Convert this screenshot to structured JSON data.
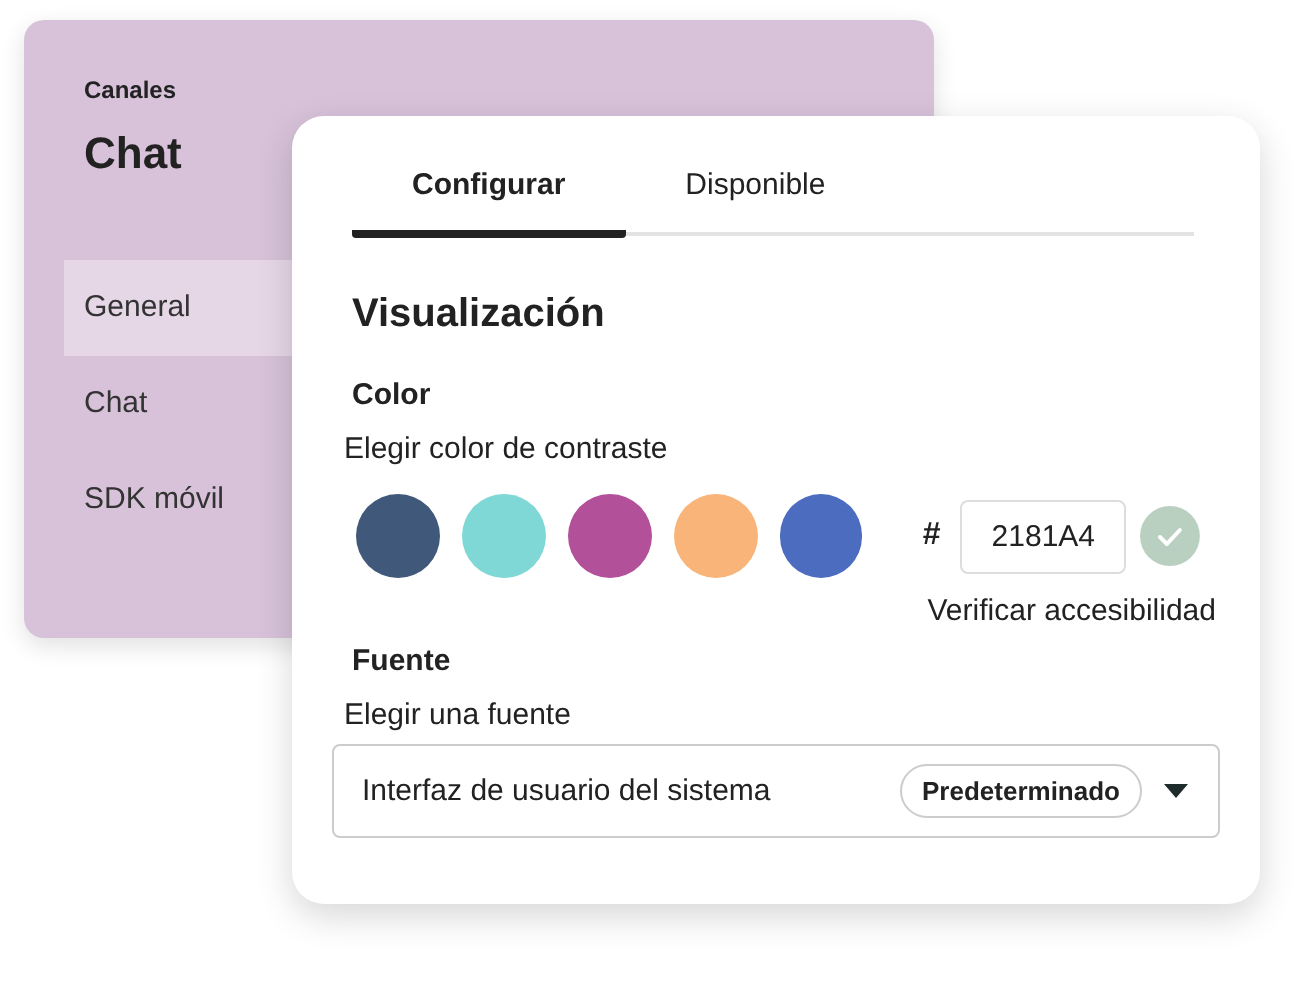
{
  "sidebar": {
    "section": "Canales",
    "title": "Chat",
    "items": [
      {
        "label": "General",
        "selected": true
      },
      {
        "label": "Chat",
        "selected": false
      },
      {
        "label": "SDK móvil",
        "selected": false
      }
    ]
  },
  "tabs": [
    {
      "label": "Configurar",
      "selected": true
    },
    {
      "label": "Disponible",
      "selected": false
    }
  ],
  "heading": "Visualización",
  "color_section": {
    "title": "Color",
    "hint": "Elegir color de contraste",
    "swatches": [
      {
        "color": "#40587a"
      },
      {
        "color": "#7fd8d6"
      },
      {
        "color": "#b2509a"
      },
      {
        "color": "#f9b47a"
      },
      {
        "color": "#4c6cc0"
      }
    ],
    "hex_prefix": "#",
    "hex_value": "2181A4",
    "confirm_disabled": true,
    "check_link": "Verificar accesibilidad"
  },
  "font_section": {
    "title": "Fuente",
    "hint": "Elegir una fuente",
    "select": {
      "value": "Interfaz de usuario del sistema",
      "badge": "Predeterminado"
    }
  }
}
